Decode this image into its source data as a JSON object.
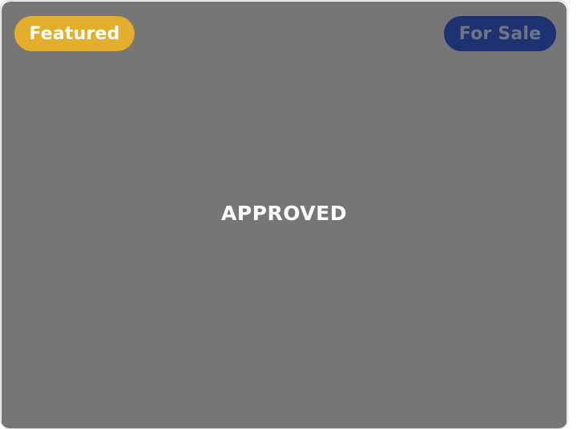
{
  "listing": {
    "featured_badge": "Featured",
    "sale_badge": "For Sale",
    "status": "APPROVED"
  },
  "colors": {
    "media_background": "#767676",
    "featured_badge_bg": "#e3ae2c",
    "featured_badge_text": "#ffffff",
    "sale_badge_bg": "#1e3272",
    "sale_badge_text": "#6f7584"
  }
}
